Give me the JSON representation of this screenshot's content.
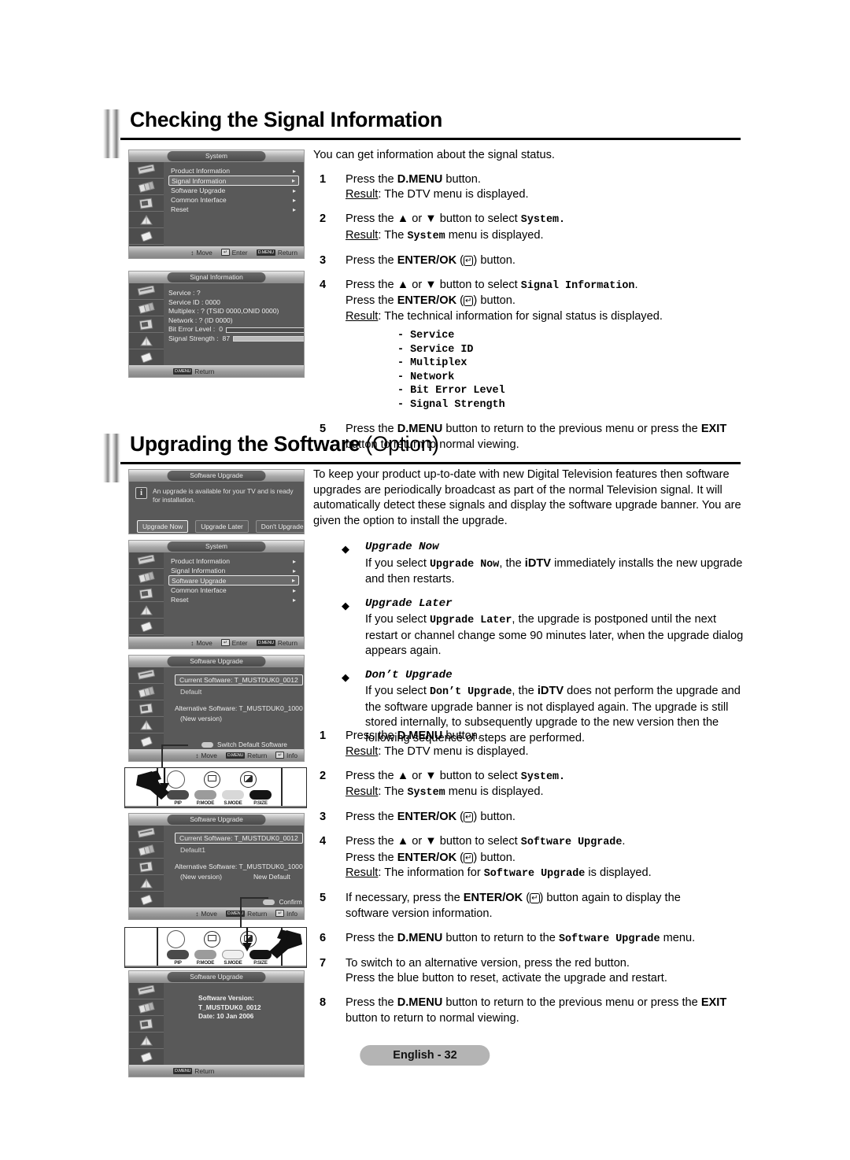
{
  "page": {
    "footer_label": "English - 32"
  },
  "section1": {
    "title": "Checking the Signal Information",
    "intro": "You can get information about the signal status.",
    "steps": [
      {
        "num": "1",
        "line1_pre": "Press the ",
        "line1_b": "D.MENU",
        "line1_post": " button.",
        "result_label": "Result",
        "result_text": ": The DTV menu is displayed."
      },
      {
        "num": "2",
        "pre": "Press the ",
        "tri_up": "▲",
        "mid": " or ",
        "tri_dn": "▼",
        "post": " button to select ",
        "mono": "System.",
        "result_label": "Result",
        "result_a": ": The ",
        "result_mono": "System",
        "result_b": " menu is displayed."
      },
      {
        "num": "3",
        "pre": "Press the ",
        "b": "ENTER/OK",
        "paren_open": " (",
        "key": "↵",
        "paren_close": ") button."
      },
      {
        "num": "4",
        "pre": "Press the ",
        "tri_up": "▲",
        "mid": " or ",
        "tri_dn": "▼",
        "post": " button to select ",
        "mono": "Signal Information",
        "period": ".",
        "line2_pre": "Press the ",
        "line2_b": "ENTER/OK",
        "line2_post": ") button.",
        "result_label": "Result",
        "result_text": ": The technical information for signal status is displayed.",
        "sublist": [
          "- Service",
          "- Service ID",
          "- Multiplex",
          "- Network",
          "- Bit Error Level",
          "- Signal Strength"
        ]
      },
      {
        "num": "5",
        "pre": "Press the ",
        "b1": "D.MENU",
        "mid": " button to return to the previous menu or press the ",
        "b2": "EXIT",
        "line2": "button to return to normal viewing."
      }
    ]
  },
  "section2": {
    "title_bold": "Upgrading the Software ",
    "title_opt": "(Option)",
    "intro": "To keep your product up-to-date with new Digital Television features then software upgrades are periodically broadcast as part of the normal Television signal. It will automatically detect these signals and display the software upgrade banner. You are given the option to install the upgrade.",
    "bullets": [
      {
        "diamond": "◆",
        "title": "Upgrade Now",
        "pre": "If you select ",
        "mono": "Upgrade Now",
        "post": ", the ",
        "b": "iDTV",
        "tail": " immediately installs the new upgrade and then restarts."
      },
      {
        "diamond": "◆",
        "title": "Upgrade Later",
        "pre": "If you select ",
        "mono": "Upgrade Later",
        "post": ", the upgrade is postponed until the next restart or channel change some 90 minutes later, when the upgrade dialog appears again."
      },
      {
        "diamond": "◆",
        "title": "Don’t Upgrade",
        "pre": "If you select ",
        "mono": "Don’t Upgrade",
        "post": ", the ",
        "b": "iDTV",
        "tail": " does not perform the upgrade and the software upgrade banner is not displayed again. The upgrade is still stored internally, to subsequently upgrade to the new version then the following sequence of steps are performed."
      }
    ],
    "steps": [
      {
        "num": "1",
        "pre": "Press the ",
        "b": "D.MENU",
        "post": " button.",
        "result_label": "Result",
        "result_text": ": The DTV menu is displayed."
      },
      {
        "num": "2",
        "pre": "Press the ",
        "tri_up": "▲",
        "mid": " or ",
        "tri_dn": "▼",
        "post": " button to select ",
        "mono": "System.",
        "result_label": "Result",
        "result_a": ": The ",
        "result_mono": "System",
        "result_b": " menu is displayed."
      },
      {
        "num": "3",
        "pre": "Press the ",
        "b": "ENTER/OK",
        "key": "↵",
        "post": ") button."
      },
      {
        "num": "4",
        "pre": "Press the ",
        "tri_up": "▲",
        "mid": " or ",
        "tri_dn": "▼",
        "post": " button to select ",
        "mono": "Software Upgrade",
        "period": ".",
        "line2_pre": "Press the ",
        "line2_b": "ENTER/OK",
        "line2_post": ") button.",
        "result_label": "Result",
        "result_a": ": The information for ",
        "result_mono": "Software Upgrade",
        "result_b": " is displayed."
      },
      {
        "num": "5",
        "pre": "If necessary, press the ",
        "b": "ENTER/OK",
        "post": ") button again to display the",
        "line2": "software version information."
      },
      {
        "num": "6",
        "pre": "Press the ",
        "b": "D.MENU",
        "mid": " button to return to the ",
        "mono": "Software Upgrade",
        "post": " menu."
      },
      {
        "num": "7",
        "line1": "To switch to an alternative version, press the red button.",
        "line2": "Press the blue button to reset, activate the upgrade and restart."
      },
      {
        "num": "8",
        "pre": "Press the ",
        "b1": "D.MENU",
        "mid": " button to return to the previous menu or press the ",
        "b2": "EXIT",
        "line2": "button to return to normal viewing."
      }
    ]
  },
  "osd_system_1": {
    "tab": "System",
    "rows": [
      {
        "label": "Product Information",
        "arrow": "▸",
        "selected": false
      },
      {
        "label": "Signal Information",
        "arrow": "▸",
        "selected": true
      },
      {
        "label": "Software Upgrade",
        "arrow": "▸",
        "selected": false
      },
      {
        "label": "Common Interface",
        "arrow": "▸",
        "selected": false
      },
      {
        "label": "Reset",
        "arrow": "▸",
        "selected": false
      }
    ],
    "foot": [
      {
        "key": "↕",
        "label": "Move",
        "style": "plain"
      },
      {
        "key": "↵",
        "label": "Enter",
        "style": "sq"
      },
      {
        "key": "D.MENU",
        "label": "Return",
        "style": "cap"
      }
    ]
  },
  "osd_signal": {
    "tab": "Signal Information",
    "lines": [
      "Service : ?",
      "Service ID : 0000",
      "Multiplex : ? (TSID 0000,ONID 0000)",
      "Network : ? (ID 0000)"
    ],
    "bit_error_label": "Bit Error Level :",
    "bit_error_value": "0",
    "bit_error_pct": 0,
    "signal_label": "Signal Strength :",
    "signal_value": "87",
    "signal_pct": 87,
    "foot": [
      {
        "key": "D.MENU",
        "label": "Return",
        "style": "cap"
      }
    ]
  },
  "osd_banner": {
    "tab": "Software Upgrade",
    "icon": "info-icon",
    "message": "An upgrade is available for your TV and is ready for installation.",
    "buttons": [
      {
        "label": "Upgrade Now",
        "selected": true
      },
      {
        "label": "Upgrade Later",
        "selected": false
      },
      {
        "label": "Don't Upgrade",
        "selected": false
      }
    ]
  },
  "osd_system_2": {
    "tab": "System",
    "rows": [
      {
        "label": "Product Information",
        "arrow": "▸",
        "selected": false
      },
      {
        "label": "Signal Information",
        "arrow": "▸",
        "selected": false
      },
      {
        "label": "Software Upgrade",
        "arrow": "▸",
        "selected": true
      },
      {
        "label": "Common Interface",
        "arrow": "▸",
        "selected": false
      },
      {
        "label": "Reset",
        "arrow": "▸",
        "selected": false
      }
    ],
    "foot": [
      {
        "key": "↕",
        "label": "Move",
        "style": "plain"
      },
      {
        "key": "↵",
        "label": "Enter",
        "style": "sq"
      },
      {
        "key": "D.MENU",
        "label": "Return",
        "style": "cap"
      }
    ]
  },
  "osd_sw_1": {
    "tab": "Software Upgrade",
    "current": "Current Software: T_MUSTDUK0_0012",
    "current_sub": "Default",
    "alternative": "Alternative Software: T_MUSTDUK0_1000",
    "alt_sub": "(New version)",
    "alt_right": "",
    "action_label": "Switch Default Software",
    "foot": [
      {
        "key": "↕",
        "label": "Move",
        "style": "plain"
      },
      {
        "key": "D.MENU",
        "label": "Return",
        "style": "cap"
      },
      {
        "key": "↵",
        "label": "Info",
        "style": "sq"
      }
    ]
  },
  "osd_sw_2": {
    "tab": "Software Upgrade",
    "current": "Current Software: T_MUSTDUK0_0012",
    "current_sub": "Default1",
    "alternative": "Alternative Software: T_MUSTDUK0_1000",
    "alt_sub": "(New version)",
    "alt_right": "New Default",
    "action_label": "Confirm",
    "foot": [
      {
        "key": "↕",
        "label": "Move",
        "style": "plain"
      },
      {
        "key": "D.MENU",
        "label": "Return",
        "style": "cap"
      },
      {
        "key": "↵",
        "label": "Info",
        "style": "sq"
      }
    ]
  },
  "osd_sw_ver": {
    "tab": "Software Upgrade",
    "version": "Software Version: T_MUSTDUK0_0012",
    "date": "Date: 10 Jan 2006",
    "foot": [
      {
        "key": "D.MENU",
        "label": "Return",
        "style": "cap"
      }
    ]
  },
  "remote_1": {
    "keys": [
      {
        "label": "PIP",
        "color": "#4a4a4a"
      },
      {
        "label": "P.MODE",
        "color": "#9b9b9b"
      },
      {
        "label": "S.MODE",
        "color": "#d8d8d8"
      },
      {
        "label": "P.SIZE",
        "color": "#141414"
      }
    ],
    "highlight": "PIP"
  },
  "remote_2": {
    "keys": [
      {
        "label": "PIP",
        "color": "#4a4a4a"
      },
      {
        "label": "P.MODE",
        "color": "#9b9b9b"
      },
      {
        "label": "S.MODE",
        "color": "#f0f0f0"
      },
      {
        "label": "P.SIZE",
        "color": "#141414"
      }
    ],
    "highlight": "P.SIZE"
  },
  "colors": {
    "osd_bg": "#595959",
    "osd_text": "#ececec",
    "footer_bg": "#b4b4b4",
    "rule": "#000000"
  }
}
